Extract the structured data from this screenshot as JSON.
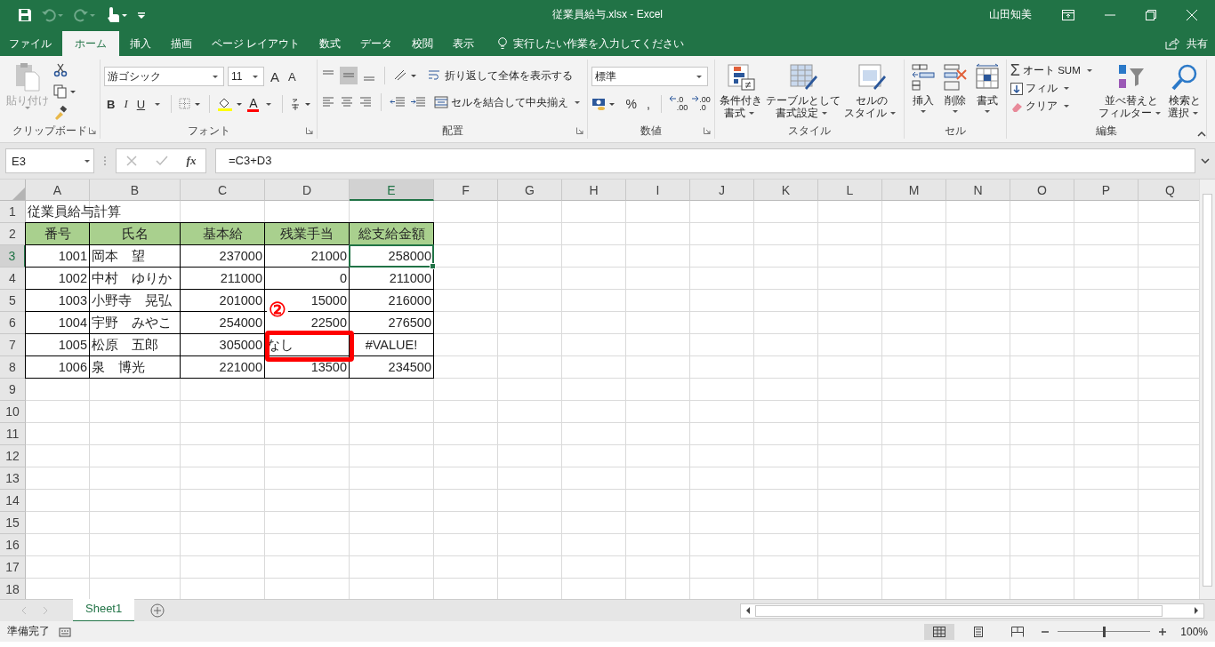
{
  "window": {
    "title": "従業員給与.xlsx  -  Excel",
    "user": "山田知美"
  },
  "tabs": [
    {
      "label": "ファイル",
      "selected": false
    },
    {
      "label": "ホーム",
      "selected": true
    },
    {
      "label": "挿入",
      "selected": false
    },
    {
      "label": "描画",
      "selected": false
    },
    {
      "label": "ページ レイアウト",
      "selected": false
    },
    {
      "label": "数式",
      "selected": false
    },
    {
      "label": "データ",
      "selected": false
    },
    {
      "label": "校閲",
      "selected": false
    },
    {
      "label": "表示",
      "selected": false
    }
  ],
  "tell_me": {
    "placeholder": "実行したい作業を入力してください"
  },
  "share": "共有",
  "ribbon": {
    "groups": [
      {
        "kind": "clipboard",
        "label": "クリップボード",
        "paste": {
          "label": "貼り付け",
          "disabled": true
        }
      },
      {
        "kind": "font",
        "label": "フォント",
        "font_name": "游ゴシック",
        "font_size": "11",
        "size_glyphs": [
          "A",
          "A"
        ],
        "style_glyphs": [
          "B",
          "I",
          "U"
        ],
        "color_glyph": "A"
      },
      {
        "kind": "alignment",
        "label": "配置",
        "wrap": "折り返して全体を表示する",
        "merge": "セルを結合して中央揃え"
      },
      {
        "kind": "number",
        "label": "数値",
        "format": "標準",
        "symbols": [
          "%",
          ","
        ],
        "decimal_buttons": [
          {
            "top": ".0",
            "bottom": ".00"
          },
          {
            "top": ".00",
            "bottom": ".0"
          }
        ]
      },
      {
        "kind": "large",
        "label": "スタイル",
        "buttons": [
          {
            "lines": [
              "条件付き",
              "書式"
            ],
            "menu_inline": true
          },
          {
            "lines": [
              "テーブルとして",
              "書式設定"
            ],
            "menu_inline": true
          },
          {
            "lines": [
              "セルの",
              "スタイル"
            ],
            "menu_inline": true
          }
        ]
      },
      {
        "kind": "large",
        "label": "セル",
        "buttons": [
          {
            "lines": [
              "挿入"
            ],
            "menu_inline": false
          },
          {
            "lines": [
              "削除"
            ],
            "menu_inline": false
          },
          {
            "lines": [
              "書式"
            ],
            "menu_inline": false
          }
        ]
      },
      {
        "kind": "editing",
        "label": "編集",
        "small": [
          {
            "glyph": "Σ",
            "label": "オート SUM"
          },
          {
            "label": "フィル"
          },
          {
            "label": "クリア"
          }
        ],
        "large": [
          {
            "lines": [
              "並べ替えと",
              "フィルター"
            ]
          },
          {
            "lines": [
              "検索と",
              "選択"
            ]
          }
        ]
      }
    ]
  },
  "formula_bar": {
    "name_box": "E3",
    "function_label": "fx",
    "formula": "=C3+D3"
  },
  "columns": [
    {
      "label": "A",
      "selected": false
    },
    {
      "label": "B",
      "selected": false
    },
    {
      "label": "C",
      "selected": false
    },
    {
      "label": "D",
      "selected": false
    },
    {
      "label": "E",
      "selected": true
    },
    {
      "label": "F",
      "selected": false
    },
    {
      "label": "G",
      "selected": false
    },
    {
      "label": "H",
      "selected": false
    },
    {
      "label": "I",
      "selected": false
    },
    {
      "label": "J",
      "selected": false
    },
    {
      "label": "K",
      "selected": false
    },
    {
      "label": "L",
      "selected": false
    },
    {
      "label": "M",
      "selected": false
    },
    {
      "label": "N",
      "selected": false
    },
    {
      "label": "O",
      "selected": false
    },
    {
      "label": "P",
      "selected": false
    },
    {
      "label": "Q",
      "selected": false
    }
  ],
  "rows": [
    {
      "header": "1",
      "kind": "title",
      "selected": false,
      "cells": [
        "従業員給与計算"
      ]
    },
    {
      "header": "2",
      "kind": "heading",
      "selected": false,
      "cells": [
        "番号",
        "氏名",
        "基本給",
        "残業手当",
        "総支給金額"
      ]
    },
    {
      "header": "3",
      "kind": "data",
      "selected": true,
      "cells": [
        "1001",
        "岡本　望",
        "237000",
        "21000",
        "258000"
      ]
    },
    {
      "header": "4",
      "kind": "data",
      "selected": false,
      "cells": [
        "1002",
        "中村　ゆりか",
        "211000",
        "0",
        "211000"
      ]
    },
    {
      "header": "5",
      "kind": "data",
      "selected": false,
      "cells": [
        "1003",
        "小野寺　晃弘",
        "201000",
        "15000",
        "216000"
      ]
    },
    {
      "header": "6",
      "kind": "data",
      "selected": false,
      "cells": [
        "1004",
        "宇野　みやこ",
        "254000",
        "22500",
        "276500"
      ]
    },
    {
      "header": "7",
      "kind": "data",
      "selected": false,
      "cells": [
        "1005",
        "松原　五郎",
        "305000",
        {
          "text": "なし",
          "flagged": true,
          "marker": "②"
        },
        "#VALUE!"
      ]
    },
    {
      "header": "8",
      "kind": "data",
      "selected": false,
      "cells": [
        "1006",
        "泉　博光",
        "221000",
        "13500",
        "234500"
      ]
    },
    {
      "header": "9",
      "selected": false
    },
    {
      "header": "10",
      "selected": false
    },
    {
      "header": "11",
      "selected": false
    },
    {
      "header": "12",
      "selected": false
    },
    {
      "header": "13",
      "selected": false
    },
    {
      "header": "14",
      "selected": false
    },
    {
      "header": "15",
      "selected": false
    },
    {
      "header": "16",
      "selected": false
    },
    {
      "header": "17",
      "selected": false
    },
    {
      "header": "18",
      "selected": false
    }
  ],
  "sheets": [
    {
      "label": "Sheet1",
      "selected": true
    }
  ],
  "status_bar": {
    "text": "準備完了",
    "zoom": {
      "level": 0.5,
      "reading": "100%"
    }
  }
}
